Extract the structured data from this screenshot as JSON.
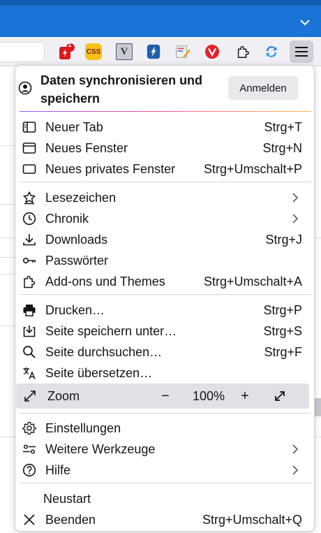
{
  "sync": {
    "title": "Daten synchronisieren und speichern",
    "signin_label": "Anmelden"
  },
  "toolbar": {
    "extensions": [
      {
        "name": "tab-counter-extension-icon",
        "badge": "1"
      },
      {
        "name": "css-extension-icon",
        "text": "CSS"
      },
      {
        "name": "v-extension-icon",
        "text": "V"
      },
      {
        "name": "lightning-extension-icon"
      },
      {
        "name": "pencil-extension-icon"
      },
      {
        "name": "vivaldi-extension-icon"
      },
      {
        "name": "puzzle-extensions-icon"
      },
      {
        "name": "sync-extension-icon"
      }
    ]
  },
  "menu": {
    "new_tab": {
      "label": "Neuer Tab",
      "shortcut": "Strg+T"
    },
    "new_window": {
      "label": "Neues Fenster",
      "shortcut": "Strg+N"
    },
    "new_private": {
      "label": "Neues privates Fenster",
      "shortcut": "Strg+Umschalt+P"
    },
    "bookmarks": {
      "label": "Lesezeichen"
    },
    "history": {
      "label": "Chronik"
    },
    "downloads": {
      "label": "Downloads",
      "shortcut": "Strg+J"
    },
    "passwords": {
      "label": "Passwörter"
    },
    "addons": {
      "label": "Add-ons und Themes",
      "shortcut": "Strg+Umschalt+A"
    },
    "print": {
      "label": "Drucken…",
      "shortcut": "Strg+P"
    },
    "save_page": {
      "label": "Seite speichern unter…",
      "shortcut": "Strg+S"
    },
    "find": {
      "label": "Seite durchsuchen…",
      "shortcut": "Strg+F"
    },
    "translate": {
      "label": "Seite übersetzen…"
    },
    "zoom": {
      "label": "Zoom",
      "minus": "−",
      "value": "100%",
      "plus": "+"
    },
    "settings": {
      "label": "Einstellungen"
    },
    "more_tools": {
      "label": "Weitere Werkzeuge"
    },
    "help": {
      "label": "Hilfe"
    },
    "restart": {
      "label": "Neustart"
    },
    "quit": {
      "label": "Beenden",
      "shortcut": "Strg+Umschalt+Q"
    }
  },
  "colors": {
    "titlebar": "#1a73d6",
    "toolbar": "#f0f0f4",
    "zoom_highlight": "#e0e0e6",
    "accent_gradient": [
      "#9059ff",
      "#ff4aa2",
      "#ffbd4f"
    ]
  }
}
